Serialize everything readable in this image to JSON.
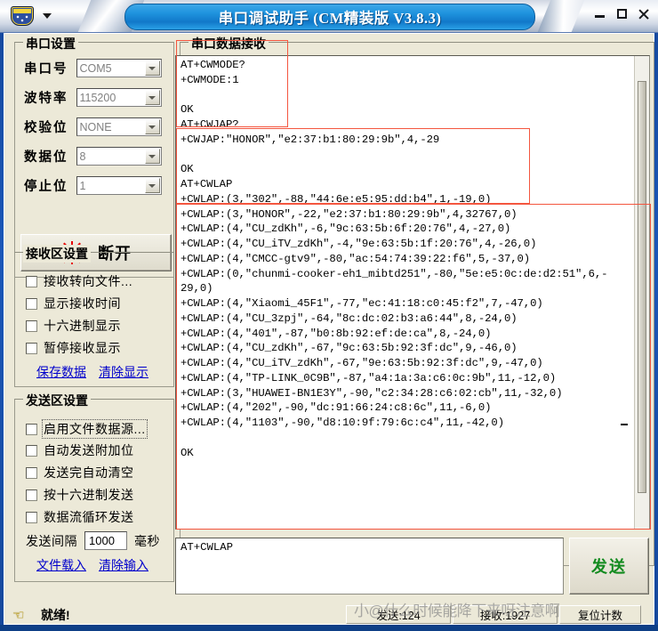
{
  "window": {
    "title": "串口调试助手 (CM精装版 V3.8.3)",
    "sysmenu_icon": "app-crest-icon",
    "minimize_label": "–",
    "maximize_label": "□",
    "close_label": "×"
  },
  "serial_settings": {
    "group_label": "串口设置",
    "fields": [
      {
        "label": "串口号",
        "value": "COM5"
      },
      {
        "label": "波特率",
        "value": "115200"
      },
      {
        "label": "校验位",
        "value": "NONE"
      },
      {
        "label": "数据位",
        "value": "8"
      },
      {
        "label": "停止位",
        "value": "1"
      }
    ],
    "connect_button": "断开"
  },
  "receive_settings": {
    "group_label": "接收区设置",
    "checkboxes": [
      {
        "label": "接收转向文件...",
        "checked": false
      },
      {
        "label": "显示接收时间",
        "checked": false
      },
      {
        "label": "十六进制显示",
        "checked": false
      },
      {
        "label": "暂停接收显示",
        "checked": false
      }
    ],
    "links": [
      {
        "label": "保存数据"
      },
      {
        "label": "清除显示"
      }
    ]
  },
  "send_settings": {
    "group_label": "发送区设置",
    "checkboxes": [
      {
        "label": "启用文件数据源...",
        "checked": false,
        "focused": true
      },
      {
        "label": "自动发送附加位",
        "checked": false
      },
      {
        "label": "发送完自动清空",
        "checked": false
      },
      {
        "label": "按十六进制发送",
        "checked": false
      },
      {
        "label": "数据流循环发送",
        "checked": false
      }
    ],
    "interval_label": "发送间隔",
    "interval_value": "1000",
    "interval_unit": "毫秒",
    "links": [
      {
        "label": "文件载入"
      },
      {
        "label": "清除输入"
      }
    ]
  },
  "receive_area": {
    "group_label": "串口数据接收",
    "lines": [
      "AT+CWMODE?",
      "+CWMODE:1",
      "",
      "OK",
      "AT+CWJAP?",
      "+CWJAP:\"HONOR\",\"e2:37:b1:80:29:9b\",4,-29",
      "",
      "OK",
      "AT+CWLAP",
      "+CWLAP:(3,\"302\",-88,\"44:6e:e5:95:dd:b4\",1,-19,0)",
      "+CWLAP:(3,\"HONOR\",-22,\"e2:37:b1:80:29:9b\",4,32767,0)",
      "+CWLAP:(4,\"CU_zdKh\",-6,\"9c:63:5b:6f:20:76\",4,-27,0)",
      "+CWLAP:(4,\"CU_iTV_zdKh\",-4,\"9e:63:5b:1f:20:76\",4,-26,0)",
      "+CWLAP:(4,\"CMCC-gtv9\",-80,\"ac:54:74:39:22:f6\",5,-37,0)",
      "+CWLAP:(0,\"chunmi-cooker-eh1_mibtd251\",-80,\"5e:e5:0c:de:d2:51\",6,-",
      "29,0)",
      "+CWLAP:(4,\"Xiaomi_45F1\",-77,\"ec:41:18:c0:45:f2\",7,-47,0)",
      "+CWLAP:(4,\"CU_3zpj\",-64,\"8c:dc:02:b3:a6:44\",8,-24,0)",
      "+CWLAP:(4,\"401\",-87,\"b0:8b:92:ef:de:ca\",8,-24,0)",
      "+CWLAP:(4,\"CU_zdKh\",-67,\"9c:63:5b:92:3f:dc\",9,-46,0)",
      "+CWLAP:(4,\"CU_iTV_zdKh\",-67,\"9e:63:5b:92:3f:dc\",9,-47,0)",
      "+CWLAP:(4,\"TP-LINK_0C9B\",-87,\"a4:1a:3a:c6:0c:9b\",11,-12,0)",
      "+CWLAP:(3,\"HUAWEI-BN1E3Y\",-90,\"c2:34:28:c6:02:cb\",11,-32,0)",
      "+CWLAP:(4,\"202\",-90,\"dc:91:66:24:c8:6c\",11,-6,0)",
      "+CWLAP:(4,\"1103\",-90,\"d8:10:9f:79:6c:c4\",11,-42,0)",
      "",
      "OK"
    ]
  },
  "send_area": {
    "value": "AT+CWLAP",
    "send_button": "发送"
  },
  "statusbar": {
    "hand_icon": "pointing-hand-icon",
    "ready_text": "就绪!",
    "cells": [
      "发送:124",
      "接收:1927",
      "复位计数"
    ],
    "watermark": "小@什么时候能降下来呀注意啊"
  },
  "colors": {
    "title_blue": "#1f93de",
    "client_bg": "#ece9d8",
    "link": "#0000cc",
    "send_green": "#128a1e",
    "annotation_red": "#f4563f",
    "led_red": "#e70000"
  }
}
